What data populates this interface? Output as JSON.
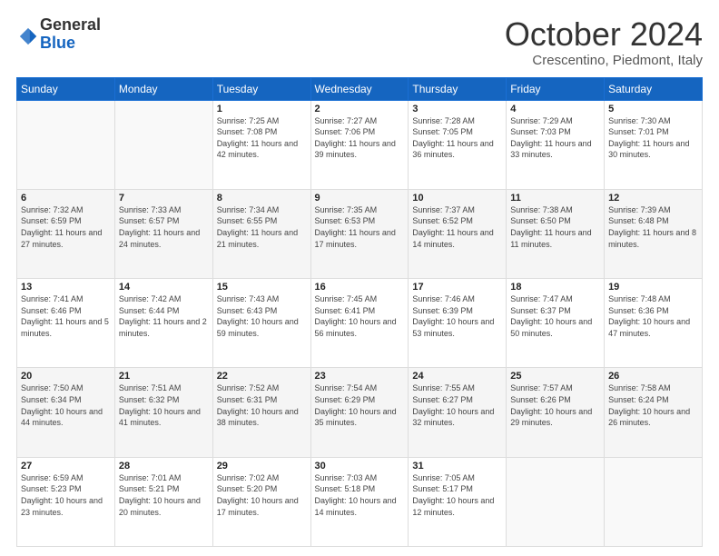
{
  "header": {
    "logo_general": "General",
    "logo_blue": "Blue",
    "month": "October 2024",
    "location": "Crescentino, Piedmont, Italy"
  },
  "weekdays": [
    "Sunday",
    "Monday",
    "Tuesday",
    "Wednesday",
    "Thursday",
    "Friday",
    "Saturday"
  ],
  "weeks": [
    [
      {
        "day": "",
        "info": ""
      },
      {
        "day": "",
        "info": ""
      },
      {
        "day": "1",
        "info": "Sunrise: 7:25 AM\nSunset: 7:08 PM\nDaylight: 11 hours and 42 minutes."
      },
      {
        "day": "2",
        "info": "Sunrise: 7:27 AM\nSunset: 7:06 PM\nDaylight: 11 hours and 39 minutes."
      },
      {
        "day": "3",
        "info": "Sunrise: 7:28 AM\nSunset: 7:05 PM\nDaylight: 11 hours and 36 minutes."
      },
      {
        "day": "4",
        "info": "Sunrise: 7:29 AM\nSunset: 7:03 PM\nDaylight: 11 hours and 33 minutes."
      },
      {
        "day": "5",
        "info": "Sunrise: 7:30 AM\nSunset: 7:01 PM\nDaylight: 11 hours and 30 minutes."
      }
    ],
    [
      {
        "day": "6",
        "info": "Sunrise: 7:32 AM\nSunset: 6:59 PM\nDaylight: 11 hours and 27 minutes."
      },
      {
        "day": "7",
        "info": "Sunrise: 7:33 AM\nSunset: 6:57 PM\nDaylight: 11 hours and 24 minutes."
      },
      {
        "day": "8",
        "info": "Sunrise: 7:34 AM\nSunset: 6:55 PM\nDaylight: 11 hours and 21 minutes."
      },
      {
        "day": "9",
        "info": "Sunrise: 7:35 AM\nSunset: 6:53 PM\nDaylight: 11 hours and 17 minutes."
      },
      {
        "day": "10",
        "info": "Sunrise: 7:37 AM\nSunset: 6:52 PM\nDaylight: 11 hours and 14 minutes."
      },
      {
        "day": "11",
        "info": "Sunrise: 7:38 AM\nSunset: 6:50 PM\nDaylight: 11 hours and 11 minutes."
      },
      {
        "day": "12",
        "info": "Sunrise: 7:39 AM\nSunset: 6:48 PM\nDaylight: 11 hours and 8 minutes."
      }
    ],
    [
      {
        "day": "13",
        "info": "Sunrise: 7:41 AM\nSunset: 6:46 PM\nDaylight: 11 hours and 5 minutes."
      },
      {
        "day": "14",
        "info": "Sunrise: 7:42 AM\nSunset: 6:44 PM\nDaylight: 11 hours and 2 minutes."
      },
      {
        "day": "15",
        "info": "Sunrise: 7:43 AM\nSunset: 6:43 PM\nDaylight: 10 hours and 59 minutes."
      },
      {
        "day": "16",
        "info": "Sunrise: 7:45 AM\nSunset: 6:41 PM\nDaylight: 10 hours and 56 minutes."
      },
      {
        "day": "17",
        "info": "Sunrise: 7:46 AM\nSunset: 6:39 PM\nDaylight: 10 hours and 53 minutes."
      },
      {
        "day": "18",
        "info": "Sunrise: 7:47 AM\nSunset: 6:37 PM\nDaylight: 10 hours and 50 minutes."
      },
      {
        "day": "19",
        "info": "Sunrise: 7:48 AM\nSunset: 6:36 PM\nDaylight: 10 hours and 47 minutes."
      }
    ],
    [
      {
        "day": "20",
        "info": "Sunrise: 7:50 AM\nSunset: 6:34 PM\nDaylight: 10 hours and 44 minutes."
      },
      {
        "day": "21",
        "info": "Sunrise: 7:51 AM\nSunset: 6:32 PM\nDaylight: 10 hours and 41 minutes."
      },
      {
        "day": "22",
        "info": "Sunrise: 7:52 AM\nSunset: 6:31 PM\nDaylight: 10 hours and 38 minutes."
      },
      {
        "day": "23",
        "info": "Sunrise: 7:54 AM\nSunset: 6:29 PM\nDaylight: 10 hours and 35 minutes."
      },
      {
        "day": "24",
        "info": "Sunrise: 7:55 AM\nSunset: 6:27 PM\nDaylight: 10 hours and 32 minutes."
      },
      {
        "day": "25",
        "info": "Sunrise: 7:57 AM\nSunset: 6:26 PM\nDaylight: 10 hours and 29 minutes."
      },
      {
        "day": "26",
        "info": "Sunrise: 7:58 AM\nSunset: 6:24 PM\nDaylight: 10 hours and 26 minutes."
      }
    ],
    [
      {
        "day": "27",
        "info": "Sunrise: 6:59 AM\nSunset: 5:23 PM\nDaylight: 10 hours and 23 minutes."
      },
      {
        "day": "28",
        "info": "Sunrise: 7:01 AM\nSunset: 5:21 PM\nDaylight: 10 hours and 20 minutes."
      },
      {
        "day": "29",
        "info": "Sunrise: 7:02 AM\nSunset: 5:20 PM\nDaylight: 10 hours and 17 minutes."
      },
      {
        "day": "30",
        "info": "Sunrise: 7:03 AM\nSunset: 5:18 PM\nDaylight: 10 hours and 14 minutes."
      },
      {
        "day": "31",
        "info": "Sunrise: 7:05 AM\nSunset: 5:17 PM\nDaylight: 10 hours and 12 minutes."
      },
      {
        "day": "",
        "info": ""
      },
      {
        "day": "",
        "info": ""
      }
    ]
  ]
}
